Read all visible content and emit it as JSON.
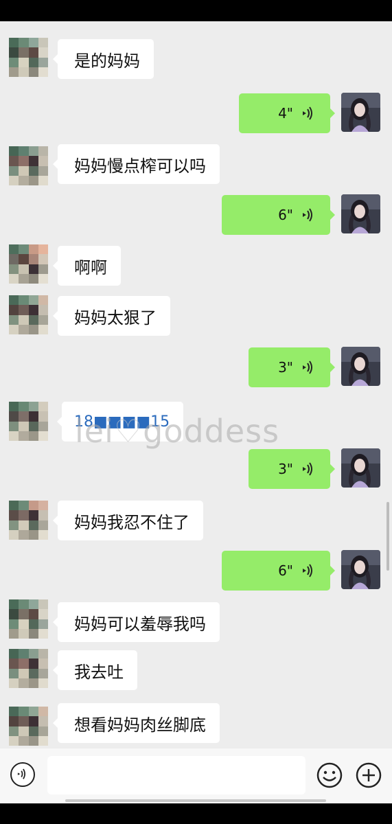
{
  "conversation": {
    "messages": [
      {
        "side": "left",
        "text": "是的妈妈"
      },
      {
        "side": "right",
        "duration": "4\""
      },
      {
        "side": "left",
        "text": "妈妈慢点榨可以吗"
      },
      {
        "side": "right",
        "duration": "6\""
      },
      {
        "side": "left",
        "text": "啊啊"
      },
      {
        "side": "left",
        "text": "妈妈太狠了"
      },
      {
        "side": "right",
        "duration": "3\""
      },
      {
        "side": "left",
        "text": "18■■■■15"
      },
      {
        "side": "right",
        "duration": "3\""
      },
      {
        "side": "left",
        "text": "妈妈我忍不住了"
      },
      {
        "side": "right",
        "duration": "6\""
      },
      {
        "side": "left",
        "text": "妈妈可以羞辱我吗"
      },
      {
        "side": "left",
        "text": "我去吐"
      },
      {
        "side": "left",
        "text": "想看妈妈肉丝脚底"
      }
    ]
  },
  "watermark": {
    "prefix": "lei",
    "heart": "♡",
    "suffix": "goddess"
  },
  "input_bar": {
    "placeholder": ""
  },
  "colors": {
    "incoming_bubble": "#ffffff",
    "outgoing_bubble": "#95ec69",
    "background": "#ededed"
  },
  "icons": {
    "voice_toggle": "voice-mode-icon",
    "emoji": "smiley-icon",
    "more": "plus-icon",
    "voice_message": "voice-wave-icon"
  }
}
